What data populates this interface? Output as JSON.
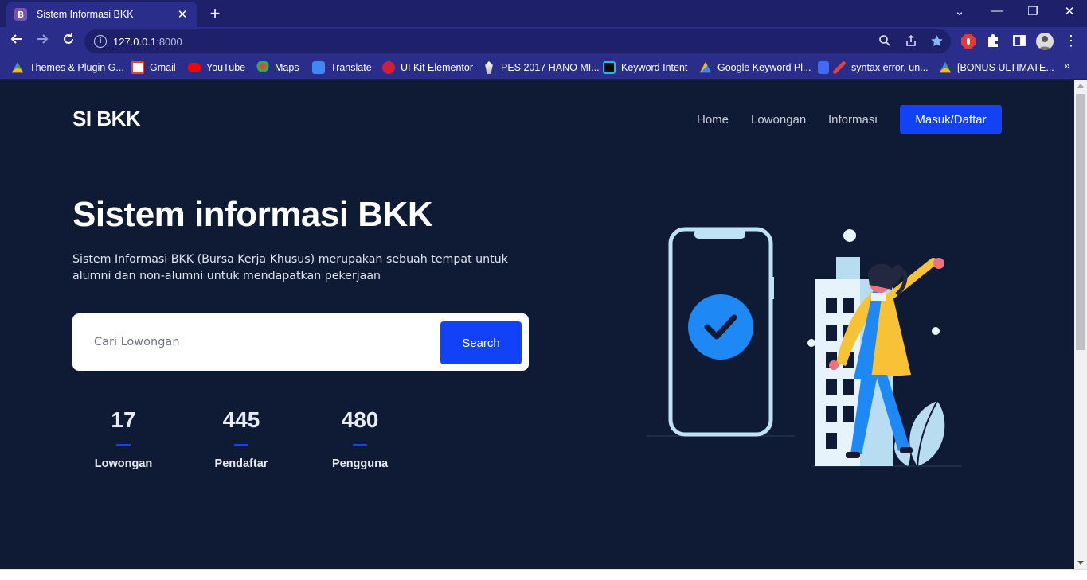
{
  "browser": {
    "tab": {
      "favicon": "B",
      "title": "Sistem Informasi BKK",
      "close": "✕"
    },
    "new_tab": "+",
    "window": {
      "dropdown": "⌄",
      "minimize": "—",
      "restore": "❐",
      "close": "✕"
    },
    "address": {
      "host": "127.0.0.1",
      "port": ":8000"
    },
    "bookmarks": [
      {
        "label": "Themes & Plugin G...",
        "color": "#34a853"
      },
      {
        "label": "Gmail",
        "color": "#ea4335"
      },
      {
        "label": "YouTube",
        "color": "#ff0000"
      },
      {
        "label": "Maps",
        "color": "#fbbc04"
      },
      {
        "label": "Translate",
        "color": "#4285f4"
      },
      {
        "label": "UI Kit Elementor",
        "color": "#d11f38"
      },
      {
        "label": "PES 2017 HANO MI...",
        "color": "#ffffff"
      },
      {
        "label": "Keyword Intent",
        "color": "#2bb7e5"
      },
      {
        "label": "Google Keyword Pl...",
        "color": "#4285f4"
      },
      {
        "label": "syntax error, un...",
        "color": "#e8413b"
      },
      {
        "label": "[BONUS ULTIMATE...",
        "color": "#fbbc04"
      }
    ],
    "bookmarks_more": "»"
  },
  "site": {
    "brand": "SI BKK",
    "nav": [
      "Home",
      "Lowongan",
      "Informasi"
    ],
    "login_button": "Masuk/Daftar",
    "hero_title": "Sistem informasi BKK",
    "hero_description": "Sistem Informasi BKK (Bursa Kerja Khusus) merupakan sebuah tempat untuk alumni dan non-alumni untuk mendapatkan pekerjaan",
    "search": {
      "placeholder": "Cari Lowongan",
      "button": "Search"
    },
    "stats": [
      {
        "value": "17",
        "label": "Lowongan"
      },
      {
        "value": "445",
        "label": "Pendaftar"
      },
      {
        "value": "480",
        "label": "Pengguna"
      }
    ],
    "accent_color": "#1142f5"
  }
}
